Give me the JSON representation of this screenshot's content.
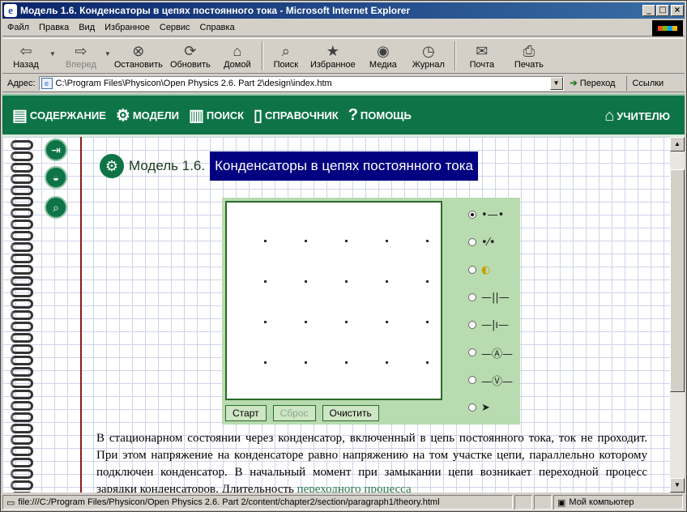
{
  "window": {
    "title": "Модель 1.6. Конденсаторы в цепях постоянного тока - Microsoft Internet Explorer"
  },
  "menu": [
    "Файл",
    "Правка",
    "Вид",
    "Избранное",
    "Сервис",
    "Справка"
  ],
  "toolbar": {
    "back": "Назад",
    "forward": "Вперед",
    "stop": "Остановить",
    "refresh": "Обновить",
    "home": "Домой",
    "search": "Поиск",
    "favorites": "Избранное",
    "media": "Медиа",
    "history": "Журнал",
    "mail": "Почта",
    "print": "Печать"
  },
  "address": {
    "label": "Адрес:",
    "url": "C:\\Program Files\\Physicon\\Open Physics 2.6. Part 2\\design\\index.htm",
    "go": "Переход",
    "links": "Ссылки"
  },
  "nav": {
    "contents": "СОДЕРЖАНИЕ",
    "models": "МОДЕЛИ",
    "search": "ПОИСК",
    "reference": "СПРАВОЧНИК",
    "help": "ПОМОЩЬ",
    "teacher": "УЧИТЕЛЮ"
  },
  "header": {
    "model_number": "Модель 1.6.",
    "model_title": "Конденсаторы в цепях постоянного тока"
  },
  "model": {
    "start": "Старт",
    "reset": "Сброс",
    "clear": "Очистить",
    "selected_tool": 0
  },
  "paragraph": {
    "text": "В стационарном состоянии через конденсатор, включенный в цепь постоянного тока, ток не проходит. При этом напряжение на конденсаторе равно напряжению на том участке цепи, параллельно которому подключен конденсатор. В начальный момент при замыкании цепи возникает переходной процесс зарядки конденсаторов. Длительность ",
    "link": "переходного процесса"
  },
  "status": {
    "url": "file:///C:/Program Files/Physicon/Open Physics 2.6. Part 2/content/chapter2/section/paragraph1/theory.html",
    "zone": "Мой компьютер"
  },
  "colors": {
    "nav_green": "#0e7447",
    "title_blue": "#000080",
    "link_green": "#2a7a4a"
  }
}
